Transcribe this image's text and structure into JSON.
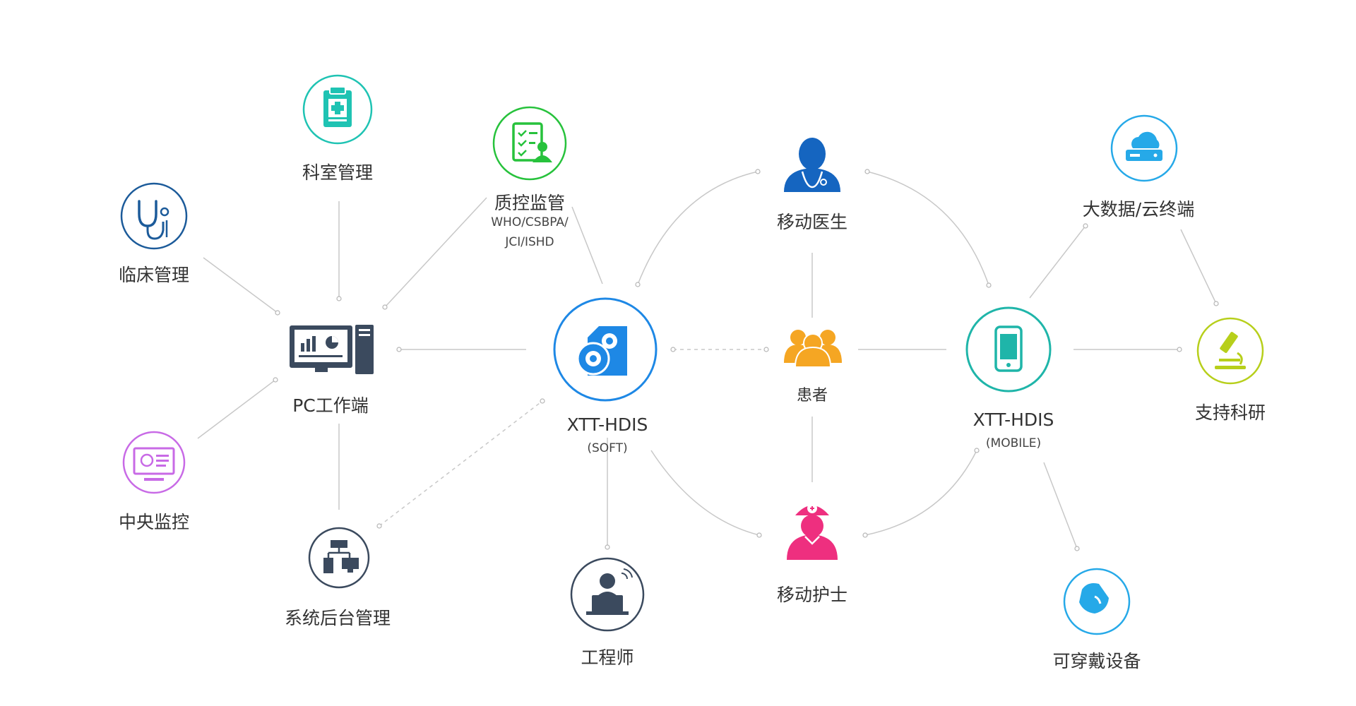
{
  "nodes": {
    "keshi": {
      "label": "科室管理"
    },
    "zhikong": {
      "label": "质控监管",
      "sub1": "WHO/CSBPA/",
      "sub2": "JCI/ISHD"
    },
    "linchuang": {
      "label": "临床管理"
    },
    "pc": {
      "label": "PC工作端"
    },
    "zhongyang": {
      "label": "中央监控"
    },
    "xitong": {
      "label": "系统后台管理"
    },
    "soft": {
      "label": "XTT-HDIS",
      "sub": "(SOFT)"
    },
    "gongcheng": {
      "label": "工程师"
    },
    "yisheng": {
      "label": "移动医生"
    },
    "huanzhe": {
      "label": "患者"
    },
    "hushi": {
      "label": "移动护士"
    },
    "mobile": {
      "label": "XTT-HDIS",
      "sub": "(MOBILE)"
    },
    "dashuju": {
      "label": "大数据/云终端"
    },
    "keyan": {
      "label": "支持科研"
    },
    "kechuan": {
      "label": "可穿戴设备"
    }
  },
  "colors": {
    "line": "#c8c8c8",
    "teal": "#1fc3b3",
    "green": "#27c23c",
    "navy": "#1c5b9a",
    "purple": "#c86ae6",
    "slate": "#3b4a5e",
    "blue": "#1e88e5",
    "darkblue": "#1565c0",
    "orange": "#f5a623",
    "pink": "#ee2f7f",
    "sky": "#26a9e8",
    "lime": "#b7cf1b"
  },
  "icons": {
    "keshi": "clipboard-medical-icon",
    "zhikong": "checklist-person-icon",
    "linchuang": "stethoscope-icon",
    "pc": "desktop-workstation-icon",
    "zhongyang": "monitor-icon",
    "xitong": "network-server-icon",
    "soft": "software-disc-gear-icon",
    "gongcheng": "engineer-laptop-icon",
    "yisheng": "doctor-icon",
    "huanzhe": "patients-group-icon",
    "hushi": "nurse-icon",
    "mobile": "smartphone-icon",
    "dashuju": "cloud-storage-icon",
    "keyan": "microscope-icon",
    "kechuan": "wearable-band-icon"
  }
}
